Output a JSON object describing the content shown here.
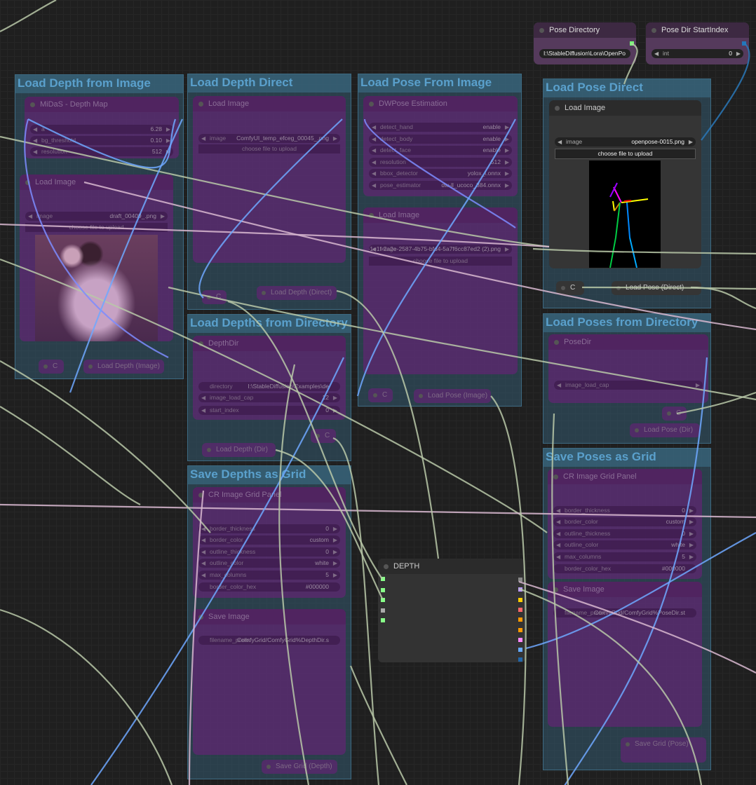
{
  "groups": [
    {
      "title": "Load Depth from Image"
    },
    {
      "title": "Load Depth Direct"
    },
    {
      "title": "Load Pose From Image"
    },
    {
      "title": "Load Pose Direct"
    },
    {
      "title": "Load Depths from Directory"
    },
    {
      "title": "Save Depths as Grid"
    },
    {
      "title": "Load Poses from Directory"
    },
    {
      "title": "Save Poses as Grid"
    }
  ],
  "nodes": {
    "midas": {
      "title": "MiDaS - Depth Map",
      "widgets": [
        {
          "label": "a",
          "value": "6.28"
        },
        {
          "label": "bg_threshold",
          "value": "0.10"
        },
        {
          "label": "resolution",
          "value": "512"
        }
      ]
    },
    "load_image_depth": {
      "title": "Load Image",
      "widgets": [
        {
          "label": "image",
          "value": "draft_00409_.png"
        }
      ],
      "button": "choose file to upload"
    },
    "load_image_direct": {
      "title": "Load Image",
      "widgets": [
        {
          "label": "image",
          "value": "ComfyUI_temp_efceg_00045_.png"
        }
      ],
      "button": "choose file to upload"
    },
    "dwpose": {
      "title": "DWPose Estimation",
      "widgets": [
        {
          "label": "detect_hand",
          "value": "enable"
        },
        {
          "label": "detect_body",
          "value": "enable"
        },
        {
          "label": "detect_face",
          "value": "enable"
        },
        {
          "label": "resolution",
          "value": "512"
        },
        {
          "label": "bbox_detector",
          "value": "yolox_l.onnx"
        },
        {
          "label": "pose_estimator",
          "value": "dw-ll_ucoco_384.onnx"
        }
      ]
    },
    "load_image_pose": {
      "title": "Load Image",
      "widgets": [
        {
          "label": "image",
          "value": "2372071f-1e1f-2a2e-2587-4b75-bfd4-5a7f6cc87ed2 (2).png"
        }
      ],
      "button": "choose file to upload"
    },
    "load_image_pose_direct": {
      "title": "Load Image",
      "widgets": [
        {
          "label": "image",
          "value": "openpose-0015.png"
        }
      ],
      "button": "choose file to upload"
    },
    "pose_directory": {
      "title": "Pose Directory",
      "widgets": [
        {
          "label": "",
          "value": "I:\\StableDiffusion\\Lora\\OpenPo"
        }
      ]
    },
    "pose_dir_startindex": {
      "title": "Pose Dir StartIndex",
      "widgets": [
        {
          "label": "int",
          "value": "0"
        }
      ]
    },
    "depthdir": {
      "title": "DepthDir",
      "widgets": [
        {
          "label": "directory",
          "value": "I:\\StableDiffusion\\Examples\\de"
        },
        {
          "label": "image_load_cap",
          "value": "12"
        },
        {
          "label": "start_index",
          "value": "0"
        }
      ]
    },
    "grid_depth": {
      "title": "CR Image Grid Panel",
      "widgets": [
        {
          "label": "border_thickness",
          "value": "0"
        },
        {
          "label": "border_color",
          "value": "custom"
        },
        {
          "label": "outline_thickness",
          "value": "0"
        },
        {
          "label": "outline_color",
          "value": "white"
        },
        {
          "label": "max_columns",
          "value": "5"
        },
        {
          "label": "border_color_hex",
          "value": "#000000"
        }
      ]
    },
    "save_depth": {
      "title": "Save Image",
      "widgets": [
        {
          "label": "filename_prefix",
          "value": "ComfyGrid/ComfyGrid%DepthDir.s"
        }
      ]
    },
    "posedir": {
      "title": "PoseDir",
      "widgets": [
        {
          "label": "image_load_cap",
          "value": ""
        }
      ]
    },
    "grid_pose": {
      "title": "CR Image Grid Panel",
      "widgets": [
        {
          "label": "border_thickness",
          "value": "0"
        },
        {
          "label": "border_color",
          "value": "custom"
        },
        {
          "label": "outline_thickness",
          "value": "0"
        },
        {
          "label": "outline_color",
          "value": "white"
        },
        {
          "label": "max_columns",
          "value": "5"
        },
        {
          "label": "border_color_hex",
          "value": "#000000"
        }
      ]
    },
    "save_pose": {
      "title": "Save Image",
      "widgets": [
        {
          "label": "filename_prefix",
          "value": "ComfyGrid/ComfyGrid%PoseDir.st"
        }
      ]
    },
    "depth": {
      "title": "DEPTH",
      "widgets": []
    }
  },
  "small_nodes": [
    {
      "label": "C"
    },
    {
      "label": "Load Depth (Image)"
    },
    {
      "label": "C"
    },
    {
      "label": "Load Depth (Direct)"
    },
    {
      "label": "C"
    },
    {
      "label": "Load Pose (Image)"
    },
    {
      "label": "C"
    },
    {
      "label": "Load Depth (Dir)"
    },
    {
      "label": "C"
    },
    {
      "label": "Load Pose (Direct)"
    },
    {
      "label": "C"
    },
    {
      "label": "Load Pose (Dir)"
    },
    {
      "label": "Save Grid (Depth)"
    },
    {
      "label": "Save Grid (Pose)"
    }
  ],
  "colors": {
    "group": "#335a70",
    "group_title": "#5aa0cc",
    "node": "#5a286e",
    "wire_image": "#6fa8ff",
    "wire_other": "#b8c8a8"
  }
}
